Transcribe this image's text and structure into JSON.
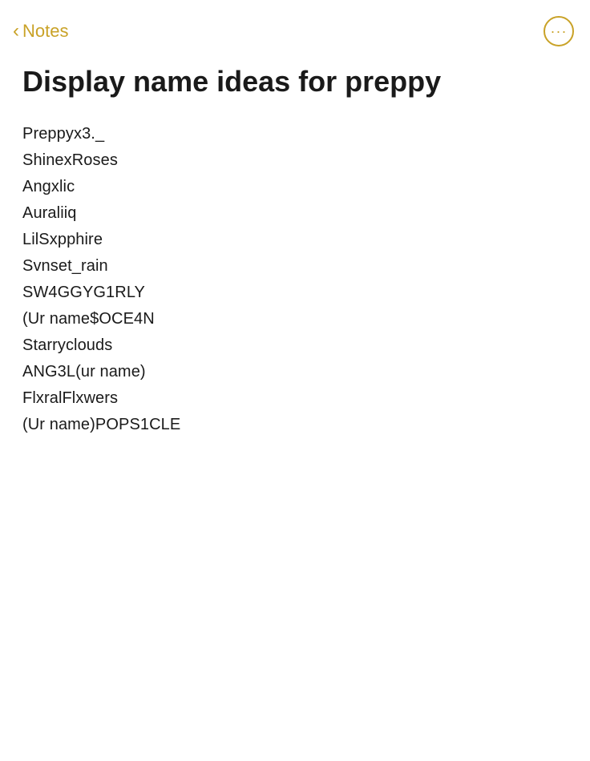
{
  "header": {
    "back_label": "Notes",
    "more_button_icon": "···"
  },
  "note": {
    "title": "Display name ideas for preppy",
    "items": [
      "Preppyx3._",
      "ShinexRoses",
      "Angxlic",
      "Auraliiq",
      "LilSxpphire",
      "Svnset_rain",
      "SW4GGYG1RLY",
      "(Ur name$OCE4N",
      "Starryclouds",
      "ANG3L(ur name)",
      "FlxralFlxwers",
      "(Ur name)POPS1CLE"
    ]
  },
  "colors": {
    "accent": "#c9a227",
    "text_primary": "#1a1a1a",
    "background": "#ffffff"
  }
}
